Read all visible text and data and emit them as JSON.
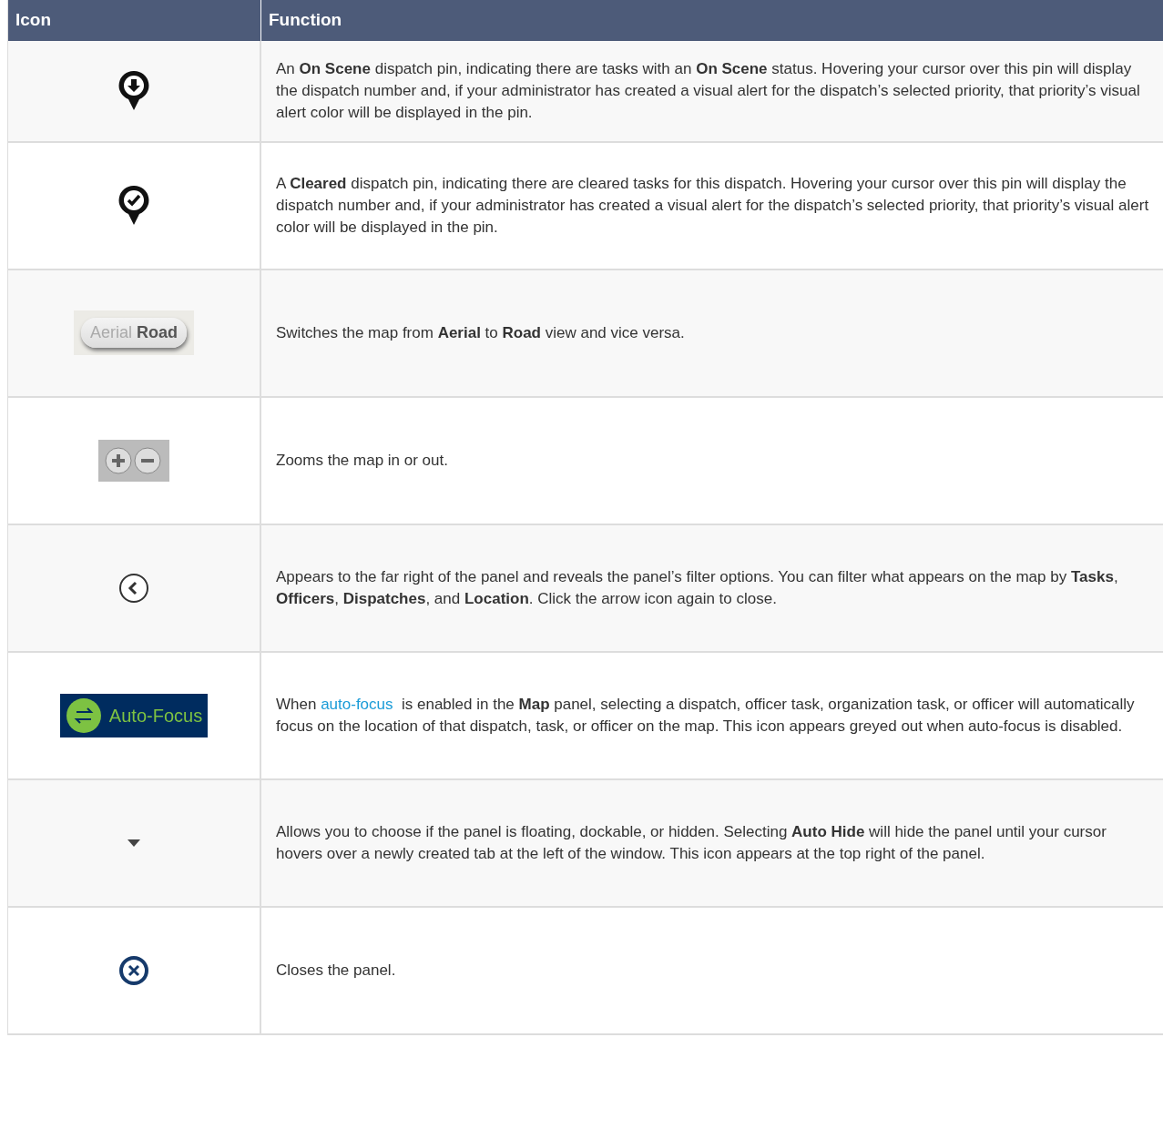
{
  "table": {
    "columns": [
      "Icon",
      "Function"
    ],
    "rows": [
      {
        "icon": {
          "kind": "pin-down"
        },
        "description": [
          {
            "kind": "text",
            "text": "An **On Scene** dispatch pin, indicating there are tasks with an **On Scene** status. Hovering your cursor over this pin will display the dispatch number and, if your administrator has created a visual alert for the dispatch’s selected priority, that priority’s visual alert color will be displayed in the pin."
          }
        ]
      },
      {
        "icon": {
          "kind": "pin-check"
        },
        "description": [
          {
            "kind": "text",
            "text": "A **Cleared** dispatch pin, indicating there are cleared tasks for this dispatch. Hovering your cursor over this pin will display the dispatch number and, if your administrator has created a visual alert for the dispatch’s selected priority, that priority’s visual alert color will be displayed in the pin."
          }
        ]
      },
      {
        "icon": {
          "kind": "toggle",
          "labels": [
            "Aerial",
            "Road"
          ]
        },
        "description": [
          {
            "kind": "text",
            "text": "Switches the map from **Aerial** to **Road** view and vice versa."
          }
        ]
      },
      {
        "icon": {
          "kind": "zoom"
        },
        "description": [
          {
            "kind": "text",
            "text": "Zooms the map in or out."
          }
        ]
      },
      {
        "icon": {
          "kind": "chevron"
        },
        "description": [
          {
            "kind": "text",
            "text": "Appears to the far right of the panel and reveals the panel’s filter options. You can filter what appears on the map by **Tasks**, **Officers**, **Dispatches**, and **Location**. Click the arrow icon again to close."
          }
        ]
      },
      {
        "icon": {
          "kind": "autofocus",
          "label": "Auto-Focus"
        },
        "description": [
          {
            "kind": "text",
            "text": "When "
          },
          {
            "kind": "link",
            "text": "auto-focus"
          },
          {
            "kind": "text",
            "text": "  is enabled in the **Map** panel, selecting a dispatch, officer task, organization task, or officer will automatically focus on the location of that dispatch, task, or officer on the map. This icon appears greyed out when auto-focus is disabled."
          }
        ]
      },
      {
        "icon": {
          "kind": "caret"
        },
        "description": [
          {
            "kind": "text",
            "text": "Allows you to choose if the panel is floating, dockable, or hidden. Selecting **Auto Hide** will hide the panel until your cursor hovers over a newly created tab at the left of the window. This icon appears at the top right of the panel."
          }
        ]
      },
      {
        "icon": {
          "kind": "close"
        },
        "description": [
          {
            "kind": "text",
            "text": "Closes the panel."
          }
        ]
      }
    ]
  }
}
